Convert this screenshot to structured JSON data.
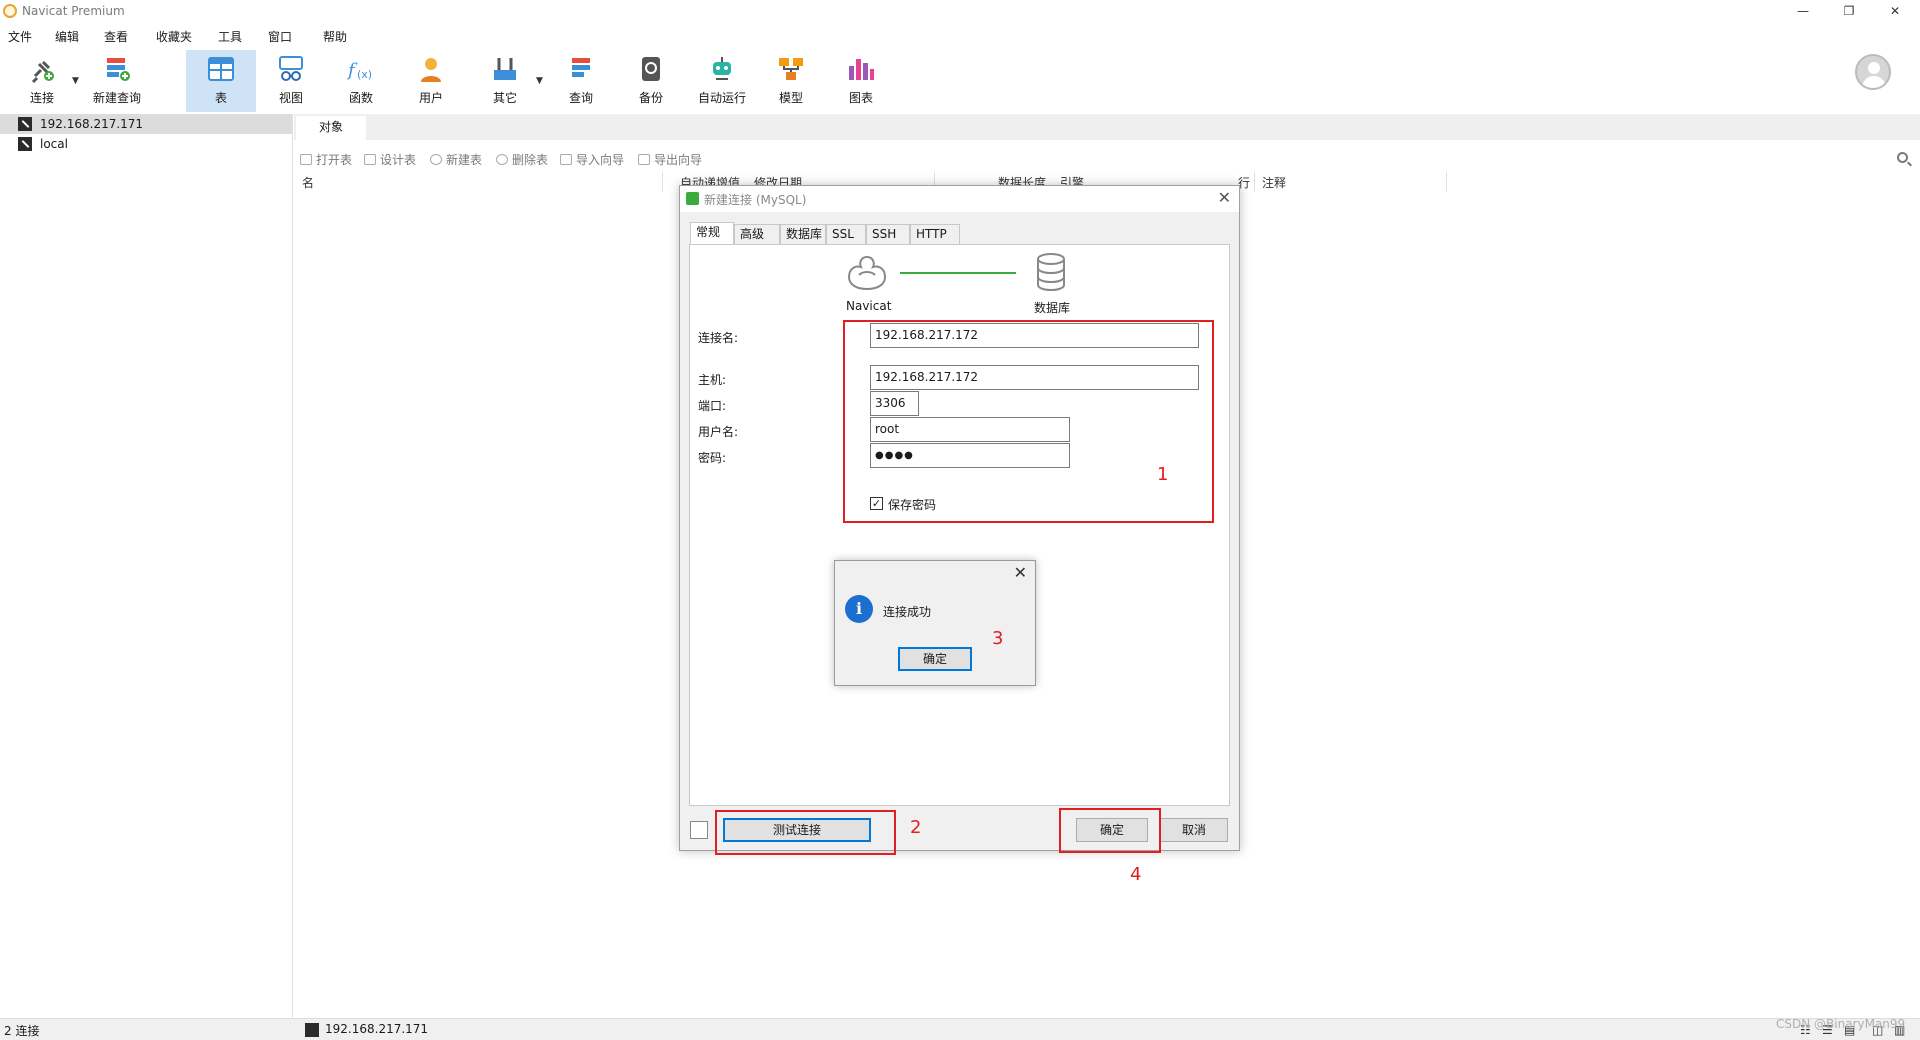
{
  "window": {
    "title": "Navicat Premium",
    "minimize": "—",
    "restore": "❐",
    "close": "✕"
  },
  "menu": [
    "文件",
    "编辑",
    "查看",
    "收藏夹",
    "工具",
    "窗口",
    "帮助"
  ],
  "toolbar": {
    "items": [
      {
        "label": "连接",
        "icon": "connect-plug-icon"
      },
      {
        "label": "新建查询",
        "icon": "new-query-icon"
      },
      {
        "label": "表",
        "icon": "table-icon",
        "active": true
      },
      {
        "label": "视图",
        "icon": "view-glasses-icon"
      },
      {
        "label": "函数",
        "icon": "function-fx-icon"
      },
      {
        "label": "用户",
        "icon": "user-icon"
      },
      {
        "label": "其它",
        "icon": "tools-icon"
      },
      {
        "label": "查询",
        "icon": "query-icon"
      },
      {
        "label": "备份",
        "icon": "backup-icon"
      },
      {
        "label": "自动运行",
        "icon": "robot-icon"
      },
      {
        "label": "模型",
        "icon": "model-icon"
      },
      {
        "label": "图表",
        "icon": "chart-icon"
      }
    ]
  },
  "nav": {
    "connections": [
      "192.168.217.171",
      "local"
    ]
  },
  "object_area": {
    "tab": "对象",
    "tools": [
      "打开表",
      "设计表",
      "新建表",
      "删除表",
      "导入向导",
      "导出向导"
    ],
    "columns": [
      "名",
      "自动递增值",
      "修改日期",
      "数据长度",
      "引擎",
      "行",
      "注释"
    ]
  },
  "dialog": {
    "title": "新建连接 (MySQL)",
    "tabs": [
      "常规",
      "高级",
      "数据库",
      "SSL",
      "SSH",
      "HTTP"
    ],
    "flow": {
      "left": "Navicat",
      "right": "数据库"
    },
    "fields": {
      "conn_name_label": "连接名:",
      "conn_name": "192.168.217.172",
      "host_label": "主机:",
      "host": "192.168.217.172",
      "port_label": "端口:",
      "port": "3306",
      "user_label": "用户名:",
      "user": "root",
      "password_label": "密码:",
      "password": "●●●●",
      "save_password": "保存密码"
    },
    "buttons": {
      "test": "测试连接",
      "ok": "确定",
      "cancel": "取消"
    }
  },
  "message": {
    "text": "连接成功",
    "ok": "确定",
    "close": "✕",
    "info": "i"
  },
  "annotations": [
    "1",
    "2",
    "3",
    "4"
  ],
  "status": {
    "count": "2 连接",
    "current": "192.168.217.171",
    "watermark": "CSDN @BinaryMan99"
  },
  "colors": {
    "accent": "#0078d7",
    "annotation": "#e02020",
    "active_tool": "#cfe3f7",
    "success_line": "#3caa3c"
  }
}
